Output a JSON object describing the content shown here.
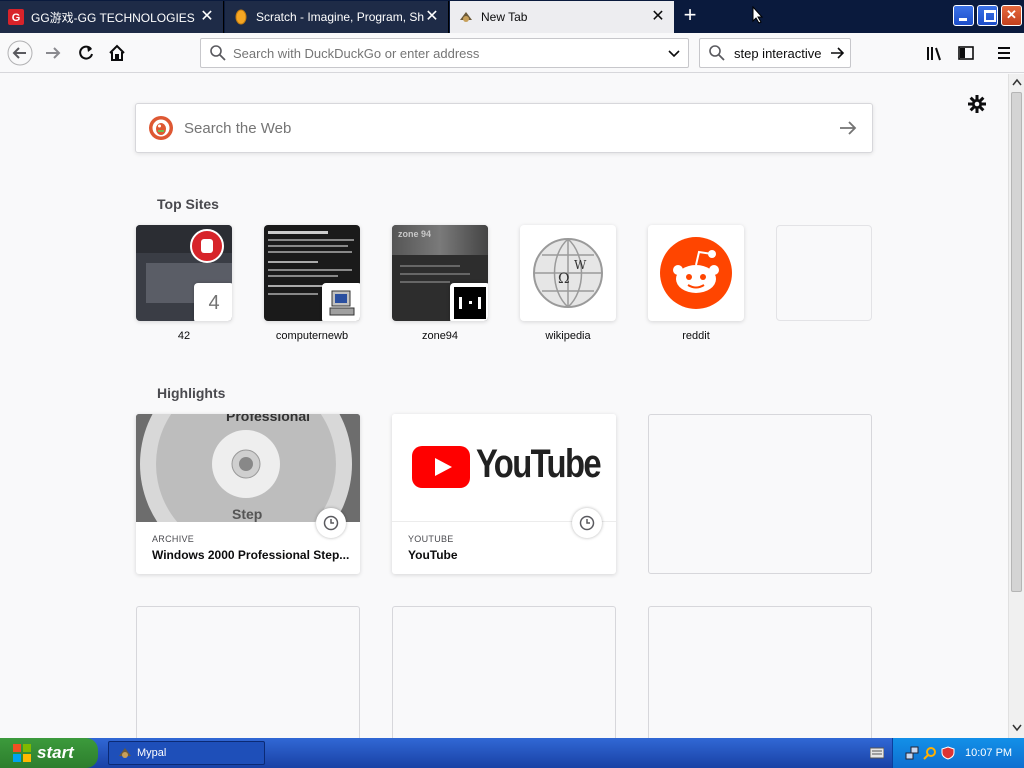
{
  "tabs": [
    {
      "title": "GG游戏-GG TECHNOLOGIES",
      "active": false
    },
    {
      "title": "Scratch - Imagine, Program, Share",
      "active": false
    },
    {
      "title": "New Tab",
      "active": true
    }
  ],
  "navbar": {
    "address_placeholder": "Search with DuckDuckGo or enter address",
    "search_value": "step interactive"
  },
  "newtab": {
    "search_placeholder": "Search the Web",
    "top_sites_title": "Top Sites",
    "top_sites": [
      {
        "label": "42",
        "badge": "4"
      },
      {
        "label": "computernewb"
      },
      {
        "label": "zone94"
      },
      {
        "label": "wikipedia"
      },
      {
        "label": "reddit"
      },
      {
        "label": ""
      }
    ],
    "highlights_title": "Highlights",
    "highlights": [
      {
        "source": "ARCHIVE",
        "title": "Windows 2000 Professional Step...",
        "image_text": "Professional",
        "image_subtext": "Step"
      },
      {
        "source": "YOUTUBE",
        "title": "YouTube",
        "logo_text": "YouTube"
      }
    ]
  },
  "taskbar": {
    "start_label": "start",
    "task_item": "Mypal",
    "clock": "10:07 PM"
  },
  "colors": {
    "tabbar": "#0a1a3d",
    "youtube_red": "#ff0000",
    "reddit_orange": "#ff4500",
    "xp_blue": "#245edb",
    "xp_green": "#3c9a3c"
  }
}
